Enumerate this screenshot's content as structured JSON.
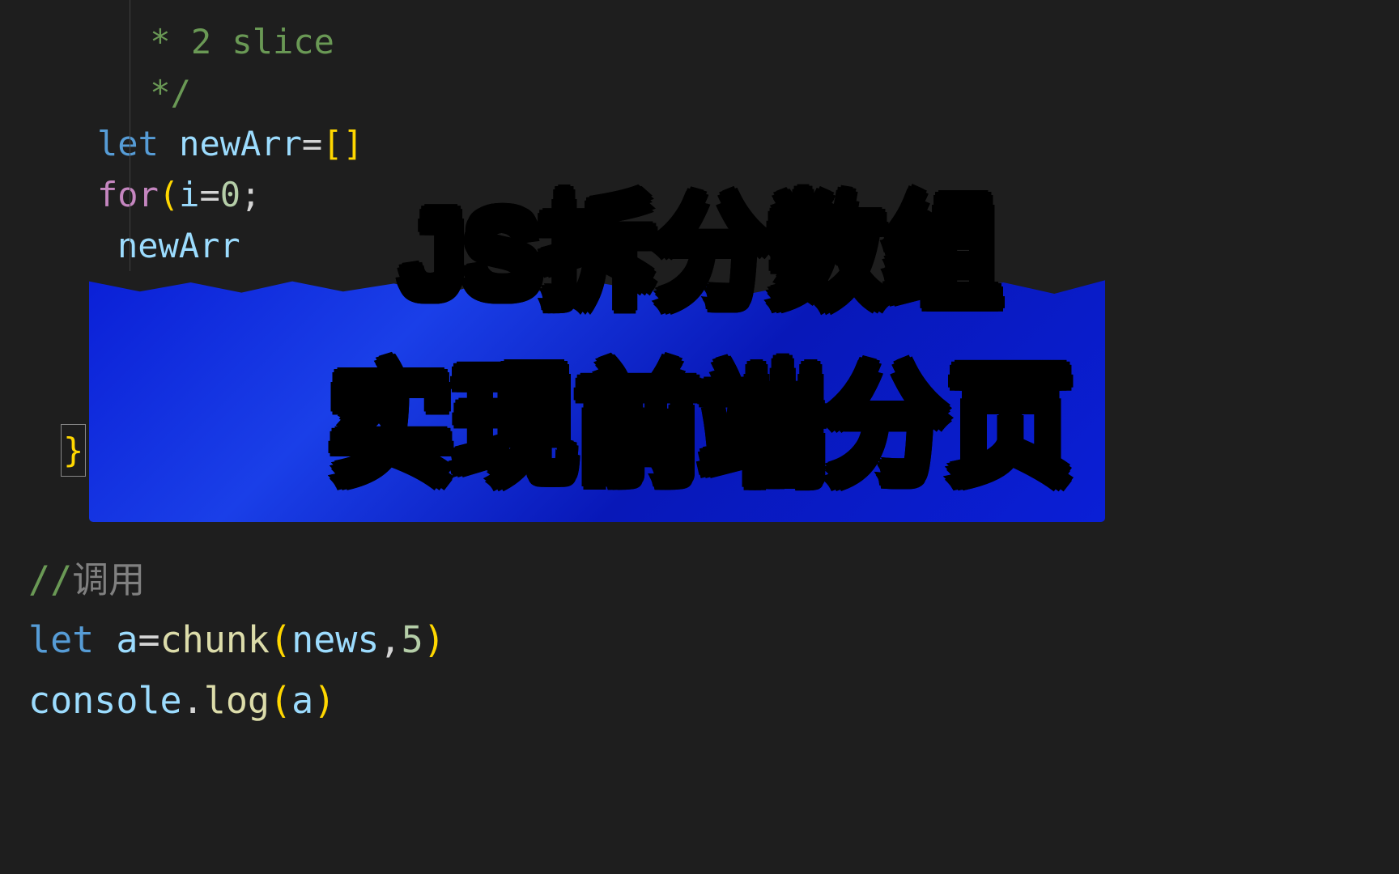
{
  "code": {
    "comment1": " * 2 slice",
    "comment2": " */",
    "let1": "let",
    "var_newArr": "newArr",
    "eq": "=",
    "open_bracket": "[",
    "close_bracket": "]",
    "for_kw": "for",
    "paren_open": "(",
    "var_i": "i",
    "eq0": "=",
    "zero": "0",
    "semicolon": ";",
    "newArr_line": "newArr",
    "closing_brace": "}"
  },
  "overlay": {
    "title_line1": "JS拆分数组",
    "title_line2": "实现前端分页"
  },
  "bottom": {
    "comment_call": "//",
    "comment_call_text": "调用",
    "let2": "let",
    "var_a": "a",
    "eq2": "=",
    "func_chunk": "chunk",
    "paren_open2": "(",
    "var_news": "news",
    "comma": ",",
    "five": "5",
    "paren_close2": ")",
    "obj_console": "console",
    "dot": ".",
    "func_log": "log",
    "paren_open3": "(",
    "var_a2": "a",
    "paren_close3": ")"
  }
}
